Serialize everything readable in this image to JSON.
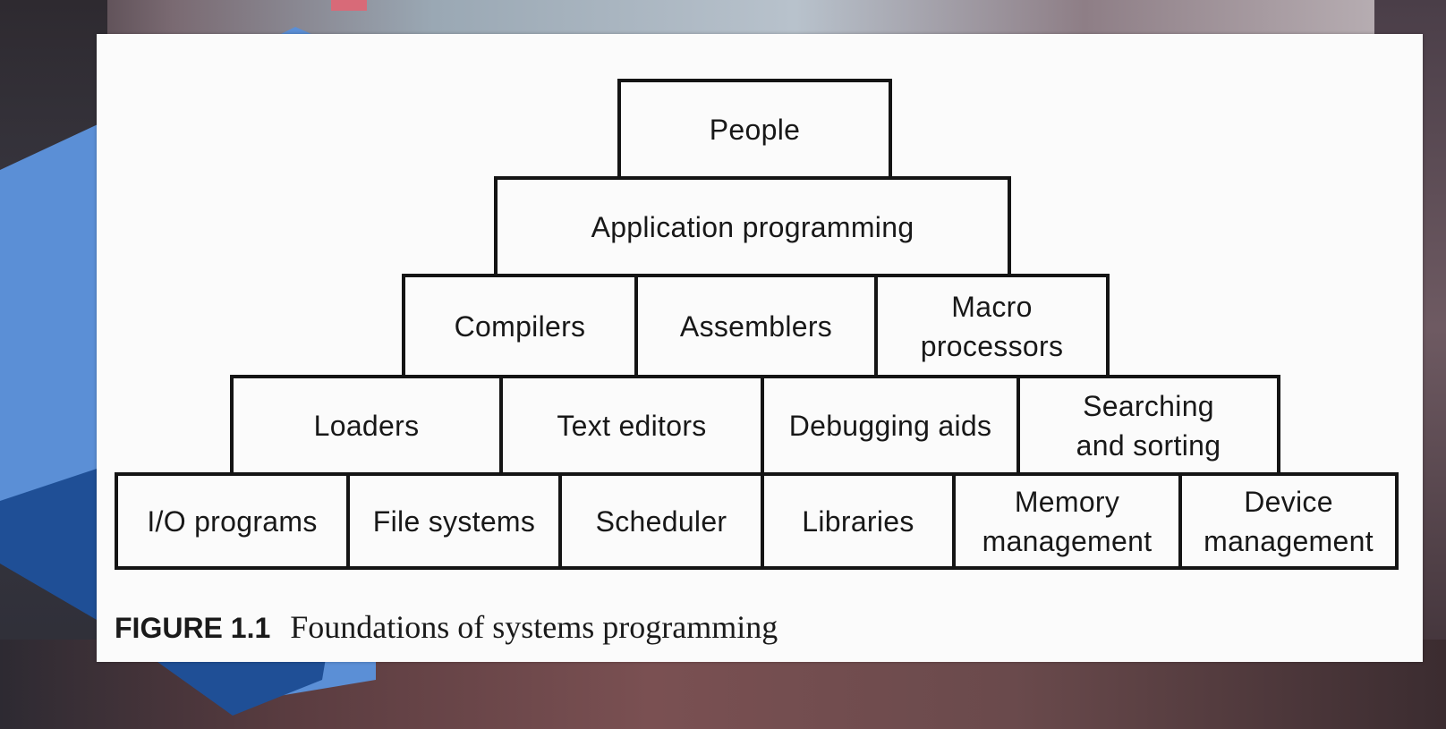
{
  "diagram": {
    "rows": [
      {
        "cells": [
          {
            "label": "People"
          }
        ]
      },
      {
        "cells": [
          {
            "label": "Application programming"
          }
        ]
      },
      {
        "cells": [
          {
            "label": "Compilers"
          },
          {
            "label": "Assemblers"
          },
          {
            "label": "Macro\nprocessors"
          }
        ]
      },
      {
        "cells": [
          {
            "label": "Loaders"
          },
          {
            "label": "Text editors"
          },
          {
            "label": "Debugging aids"
          },
          {
            "label": "Searching\nand sorting"
          }
        ]
      },
      {
        "cells": [
          {
            "label": "I/O programs"
          },
          {
            "label": "File systems"
          },
          {
            "label": "Scheduler"
          },
          {
            "label": "Libraries"
          },
          {
            "label": "Memory\nmanagement"
          },
          {
            "label": "Device\nmanagement"
          }
        ]
      }
    ]
  },
  "caption": {
    "figure_number": "FIGURE 1.1",
    "title": "Foundations of systems programming"
  },
  "colors": {
    "slide_background": "#fbfbfb",
    "box_border": "#141414",
    "accent_blue": "#5b8fd6",
    "accent_navy": "#1f4f96"
  }
}
